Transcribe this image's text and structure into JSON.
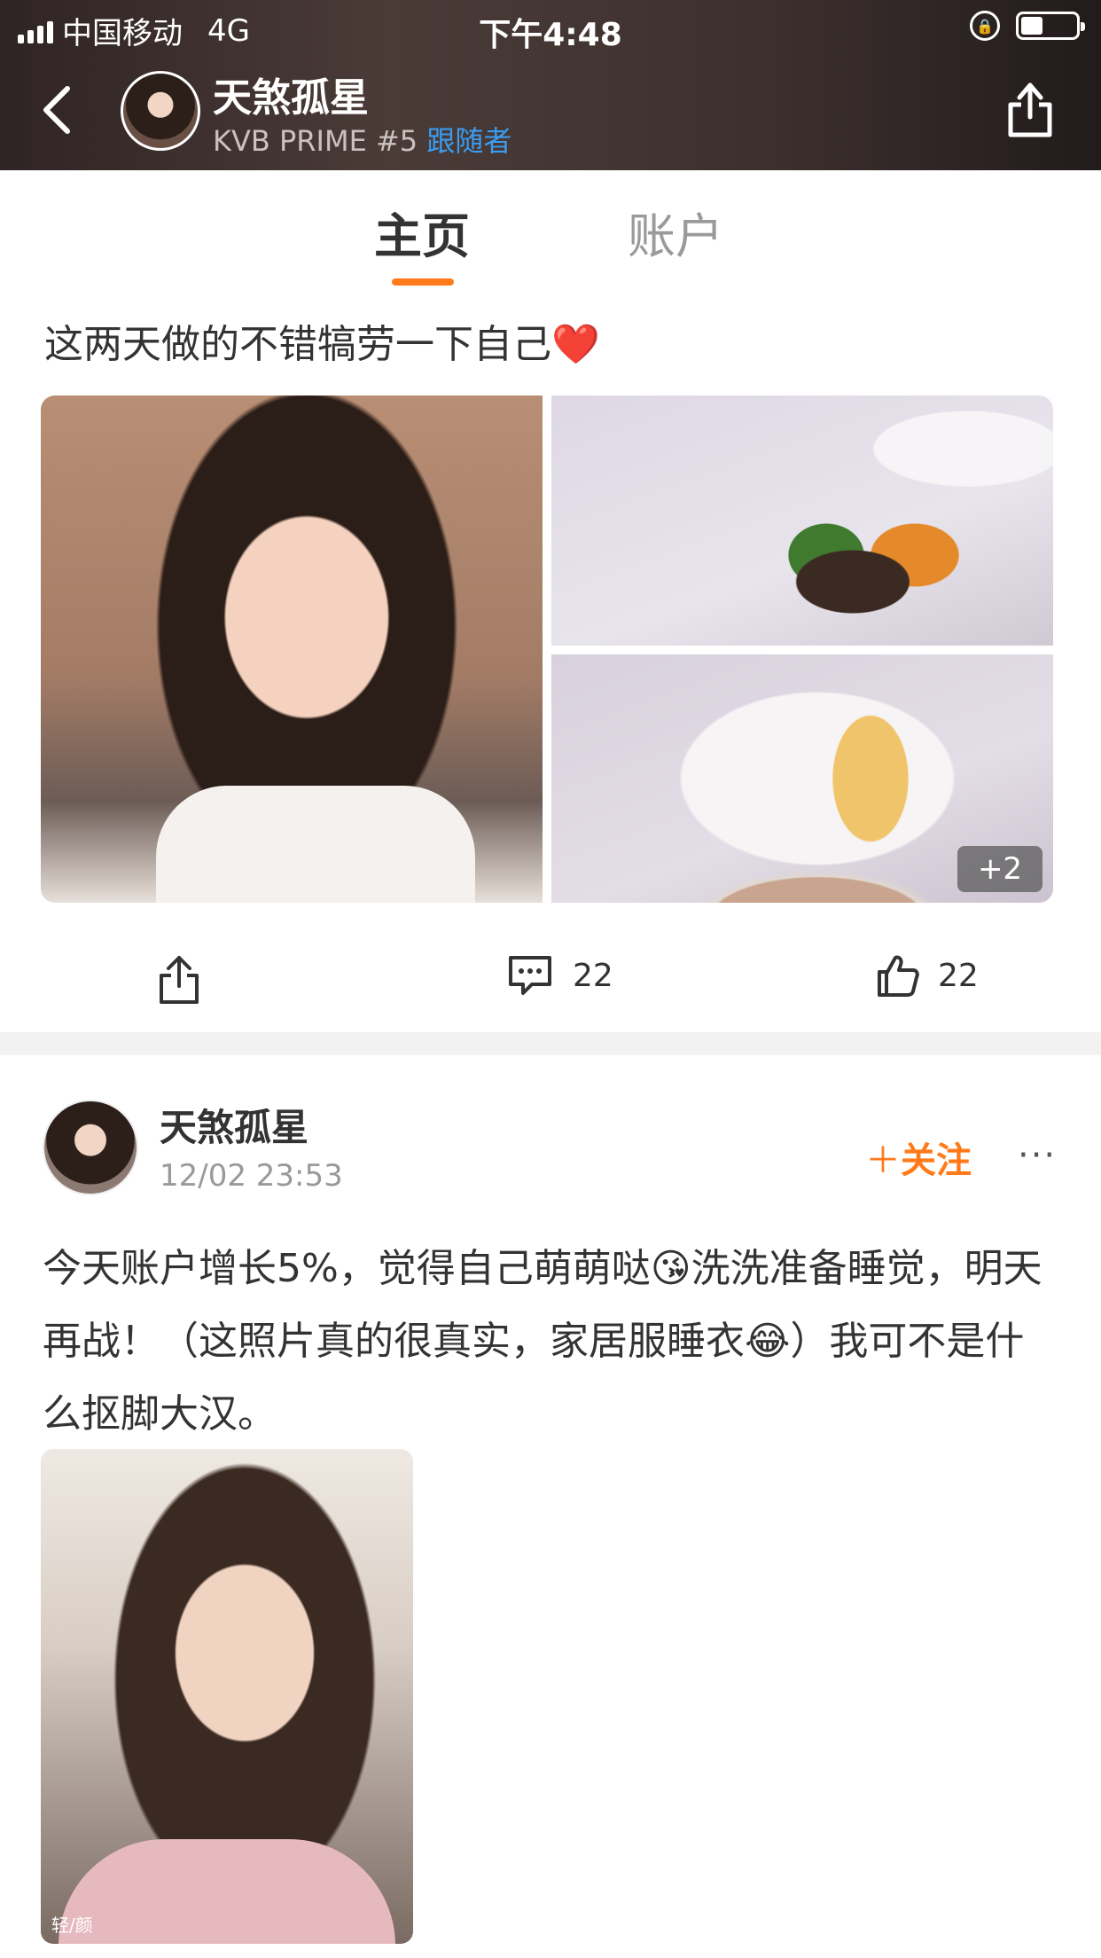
{
  "status_bar": {
    "carrier": "中国移动",
    "network": "4G",
    "time": "下午4:48"
  },
  "header": {
    "name": "天煞孤星",
    "subtitle": "KVB PRIME #5",
    "follow_status": "跟随者"
  },
  "tabs": [
    {
      "label": "主页",
      "active": true
    },
    {
      "label": "账户",
      "active": false
    }
  ],
  "post1": {
    "text": "这两天做的不错犒劳一下自己❤️",
    "more_images": "+2",
    "comments": "22",
    "likes": "22"
  },
  "post2": {
    "author": "天煞孤星",
    "time": "12/02 23:53",
    "follow_label": "关注",
    "more": "···",
    "text": "今天账户增长5%，觉得自己萌萌哒😘洗洗准备睡觉，明天再战！（这照片真的很真实，家居服睡衣😂）我可不是什么抠脚大汉。",
    "watermark": "轻/颜"
  },
  "colors": {
    "accent": "#ff7a1a",
    "link_blue": "#3b9cf0",
    "header_bg": "#3c302e"
  }
}
